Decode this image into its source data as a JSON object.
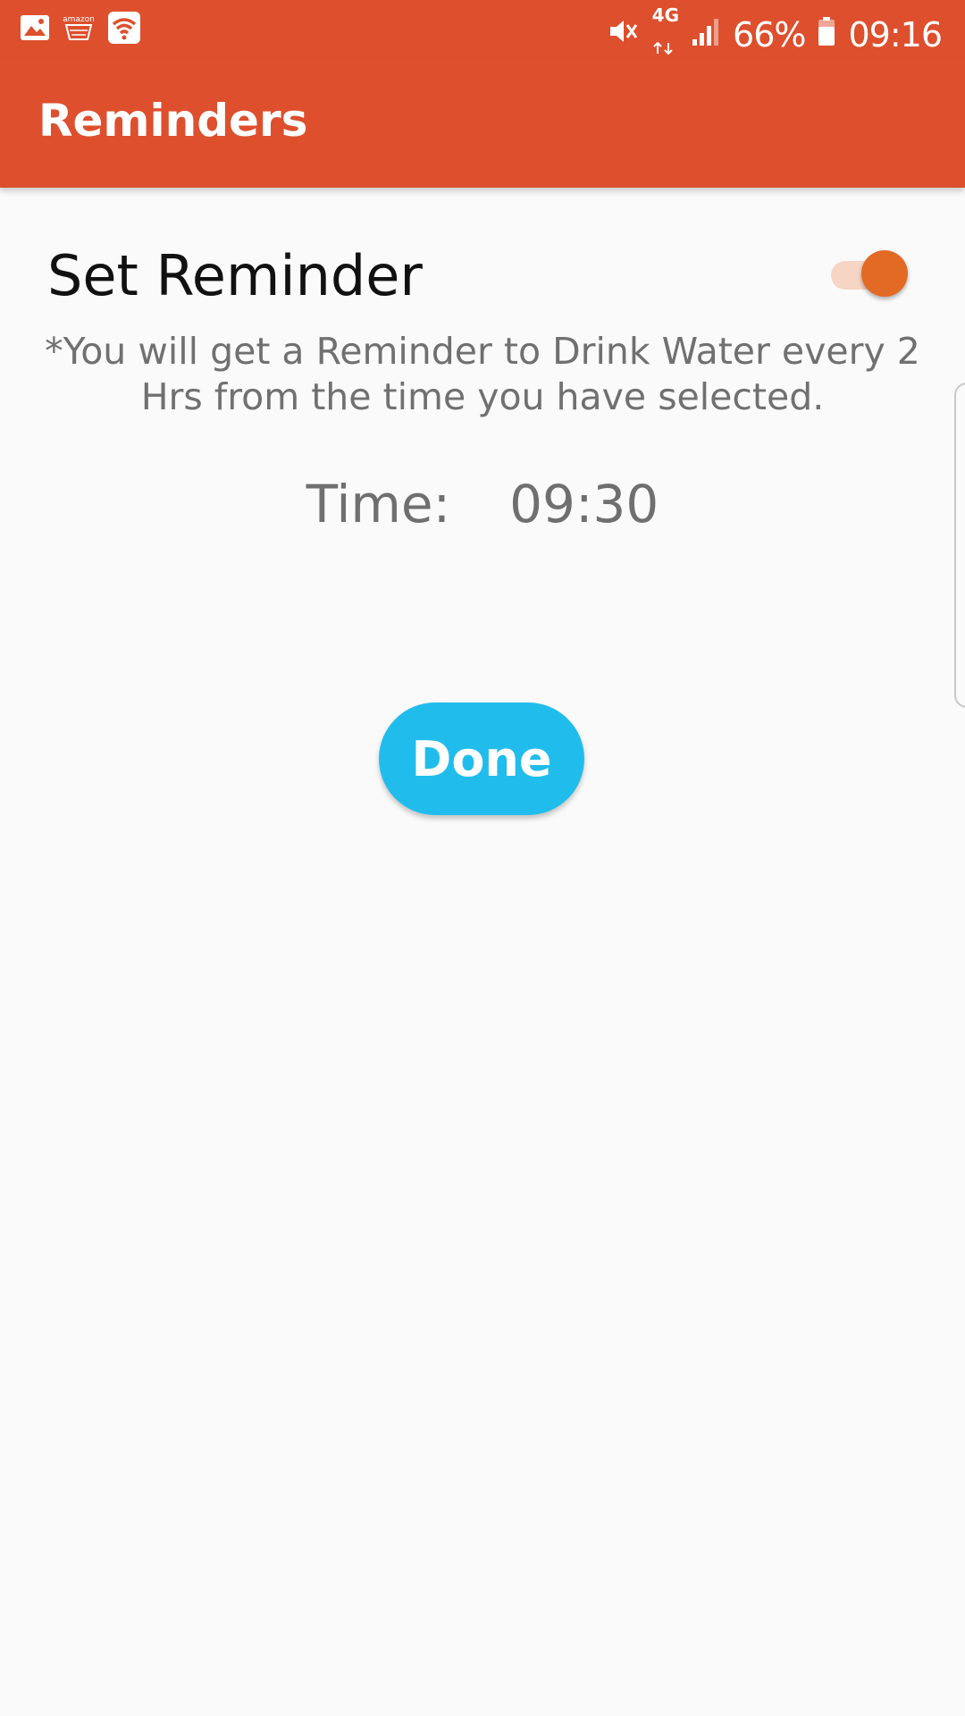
{
  "status_bar": {
    "left_icons": [
      "gallery-icon",
      "amazon-icon",
      "wifi-hotspot-icon"
    ],
    "network_label": "4G",
    "battery_percent": "66%",
    "clock": "09:16"
  },
  "app_bar": {
    "title": "Reminders"
  },
  "reminder": {
    "label": "Set Reminder",
    "enabled": true,
    "info": "*You will get a Reminder to Drink Water every 2 Hrs from the time you have selected.",
    "time_label": "Time:",
    "time_value": "09:30"
  },
  "actions": {
    "done_label": "Done"
  },
  "colors": {
    "primary": "#dd4f2d",
    "accent": "#e36a25",
    "button": "#20bdec"
  }
}
